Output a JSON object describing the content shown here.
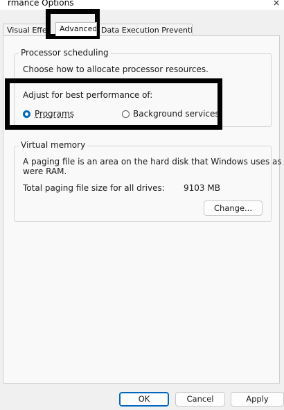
{
  "window": {
    "title": "rmance Options",
    "close_glyph": "×"
  },
  "tabs": [
    {
      "label": "Visual Effects",
      "active": false
    },
    {
      "label": "Advanced",
      "active": true
    },
    {
      "label": "Data Execution Prevention",
      "active": false
    }
  ],
  "processor_scheduling": {
    "legend": "Processor scheduling",
    "description": "Choose how to allocate processor resources.",
    "adjust_label": "Adjust for best performance of:",
    "options": [
      {
        "label": "Programs",
        "checked": true
      },
      {
        "label": "Background services",
        "checked": false
      }
    ]
  },
  "virtual_memory": {
    "legend": "Virtual memory",
    "description_line1": "A paging file is an area on the hard disk that Windows uses as if it",
    "description_line2": "were RAM.",
    "total_label": "Total paging file size for all drives:",
    "total_value": "9103 MB",
    "change_button": "Change..."
  },
  "footer": {
    "ok": "OK",
    "cancel": "Cancel",
    "apply": "Apply"
  },
  "colors": {
    "accent": "#0067c0",
    "highlight_box": "#000000"
  },
  "icons": {
    "close": "close-icon",
    "radio_selected": "radio-selected-icon",
    "radio_unselected": "radio-unselected-icon"
  }
}
